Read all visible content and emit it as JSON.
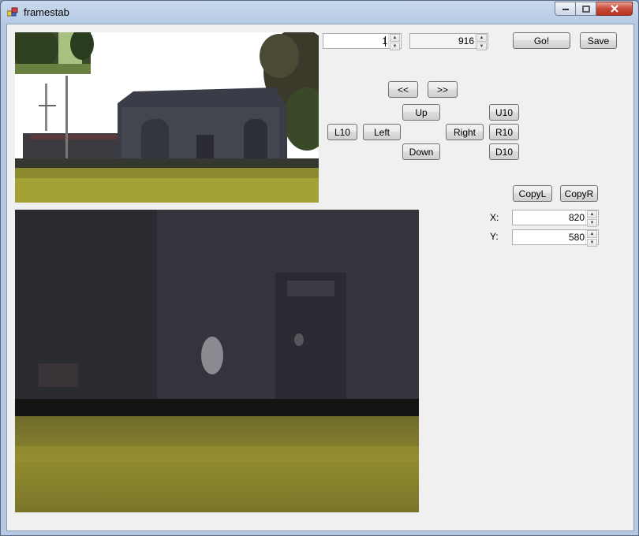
{
  "window": {
    "title": "framestab"
  },
  "controls": {
    "frame_value": "1",
    "total_value": "916",
    "go_label": "Go!",
    "save_label": "Save",
    "prev_label": "<<",
    "next_label": ">>",
    "up_label": "Up",
    "down_label": "Down",
    "left_label": "Left",
    "right_label": "Right",
    "l10_label": "L10",
    "u10_label": "U10",
    "r10_label": "R10",
    "d10_label": "D10",
    "copyl_label": "CopyL",
    "copyr_label": "CopyR",
    "x_label": "X:",
    "x_value": "820",
    "y_label": "Y:",
    "y_value": "580"
  },
  "colors": {
    "client_bg": "#f0f0f0",
    "close_button": "#c74a38"
  },
  "icons": [
    "app-icon",
    "minimize-icon",
    "maximize-icon",
    "close-icon",
    "spin-up-icon",
    "spin-down-icon"
  ]
}
